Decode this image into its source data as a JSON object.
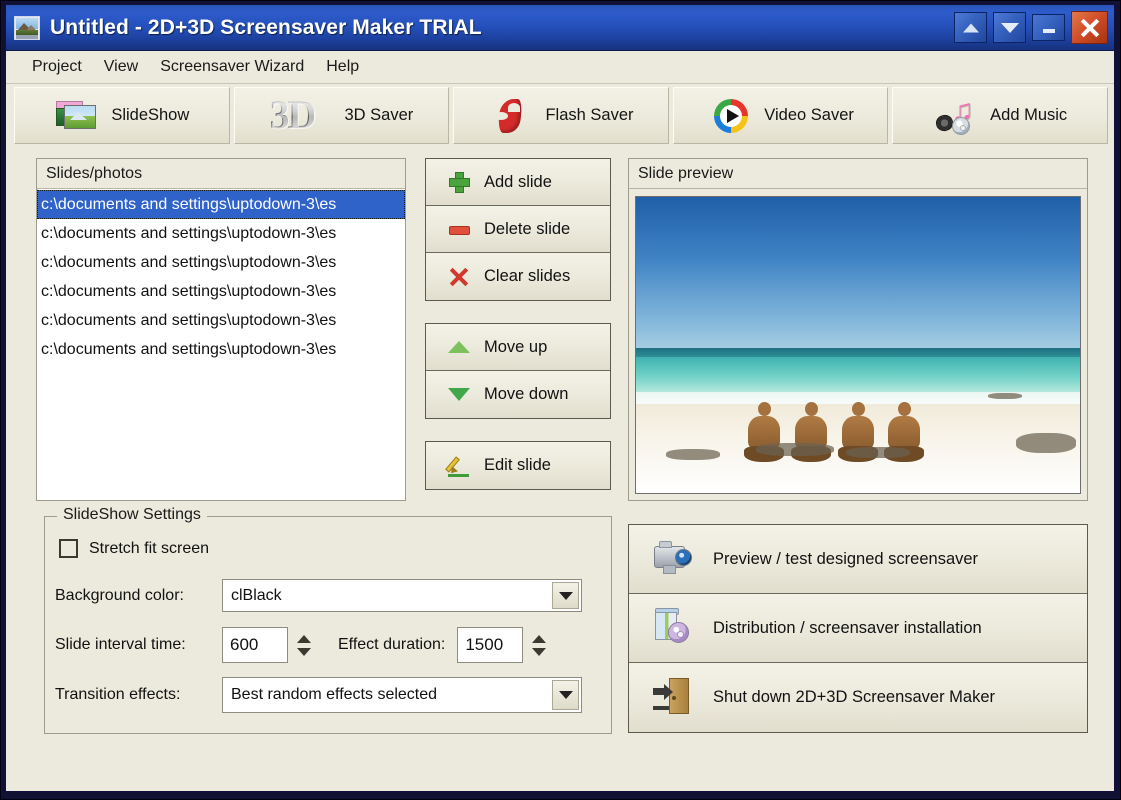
{
  "window": {
    "title": "Untitled - 2D+3D Screensaver Maker TRIAL",
    "app_icon": "photo-monitor-icon",
    "titlebar_color": "#2550bb",
    "close_button_color": "#d2502a",
    "buttons": [
      {
        "name": "rollup-button",
        "icon": "triangle-up-icon"
      },
      {
        "name": "dropdown-button",
        "icon": "triangle-down-icon"
      },
      {
        "name": "minimize-button",
        "icon": "minimize-icon"
      },
      {
        "name": "close-button",
        "icon": "close-x-icon"
      }
    ]
  },
  "menubar": {
    "items": [
      {
        "label": "Project"
      },
      {
        "label": "View"
      },
      {
        "label": "Screensaver Wizard"
      },
      {
        "label": "Help"
      }
    ]
  },
  "toolbar": {
    "items": [
      {
        "label": "SlideShow",
        "icon": "slideshow-photos-icon"
      },
      {
        "label": "3D Saver",
        "icon": "3d-text-icon",
        "glyph": "3D"
      },
      {
        "label": "Flash Saver",
        "icon": "flash-f-icon"
      },
      {
        "label": "Video Saver",
        "icon": "video-color-wheel-play-icon"
      },
      {
        "label": "Add Music",
        "icon": "music-note-speaker-cd-icon"
      }
    ]
  },
  "slides": {
    "header": "Slides/photos",
    "selected_index": 0,
    "items": [
      "c:\\documents and settings\\uptodown-3\\es",
      "c:\\documents and settings\\uptodown-3\\es",
      "c:\\documents and settings\\uptodown-3\\es",
      "c:\\documents and settings\\uptodown-3\\es",
      "c:\\documents and settings\\uptodown-3\\es",
      "c:\\documents and settings\\uptodown-3\\es"
    ]
  },
  "slide_buttons": {
    "groups": [
      [
        {
          "label": "Add slide",
          "icon": "plus-green-icon"
        },
        {
          "label": "Delete slide",
          "icon": "minus-red-icon"
        },
        {
          "label": "Clear slides",
          "icon": "x-red-icon"
        }
      ],
      [
        {
          "label": "Move up",
          "icon": "triangle-up-green-icon"
        },
        {
          "label": "Move down",
          "icon": "triangle-down-green-icon"
        }
      ],
      [
        {
          "label": "Edit slide",
          "icon": "pencil-icon"
        }
      ]
    ]
  },
  "preview": {
    "header": "Slide preview",
    "image_description": "beach-photo-four-men-on-white-sand"
  },
  "settings": {
    "legend": "SlideShow Settings",
    "stretch_fit": {
      "label": "Stretch fit screen",
      "checked": false
    },
    "background_color": {
      "label": "Background color:",
      "value": "clBlack"
    },
    "slide_interval": {
      "label": "Slide interval time:",
      "value": "600"
    },
    "effect_duration": {
      "label": "Effect duration:",
      "value": "1500"
    },
    "transition_effects": {
      "label": "Transition effects:",
      "value": "Best random effects selected"
    }
  },
  "actions": {
    "items": [
      {
        "label": "Preview / test designed screensaver",
        "icon": "video-camera-icon"
      },
      {
        "label": "Distribution / screensaver installation",
        "icon": "cd-install-icon"
      },
      {
        "label": "Shut down 2D+3D Screensaver Maker",
        "icon": "exit-door-icon"
      }
    ]
  }
}
